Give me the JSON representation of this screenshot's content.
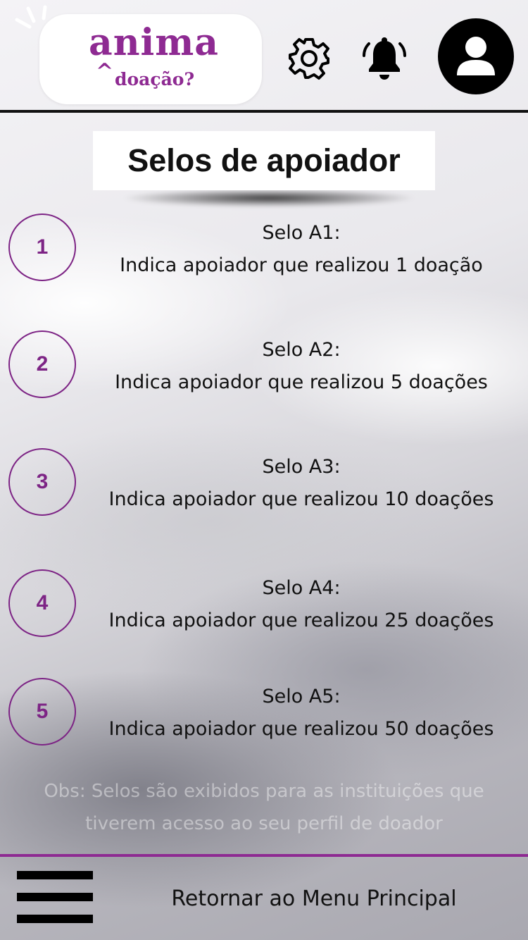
{
  "header": {
    "logo_main": "anima",
    "logo_accent": "^",
    "logo_sub": "doação?",
    "icons": [
      "gear-icon",
      "bell-icon",
      "user-avatar-icon"
    ]
  },
  "page": {
    "title": "Selos de apoiador"
  },
  "seals": [
    {
      "number": "1",
      "name": "Selo A1:",
      "description": "Indica apoiador que realizou 1 doação"
    },
    {
      "number": "2",
      "name": "Selo A2:",
      "description": "Indica apoiador que realizou 5 doações"
    },
    {
      "number": "3",
      "name": "Selo A3:",
      "description": "Indica apoiador que realizou 10 doações"
    },
    {
      "number": "4",
      "name": "Selo A4:",
      "description": "Indica apoiador que realizou 25 doações"
    },
    {
      "number": "5",
      "name": "Selo A5:",
      "description": "Indica apoiador que realizou 50 doações"
    }
  ],
  "note": {
    "line1": "Obs: Selos são exibidos para as instituições que",
    "line2": "tiverem acesso ao seu perfil de doador"
  },
  "footer": {
    "return_label": "Retornar ao Menu Principal",
    "menu_icon": "hamburger-icon"
  },
  "colors": {
    "brand_purple": "#8e2a92",
    "badge_purple": "#7d2485",
    "text": "#111111"
  }
}
